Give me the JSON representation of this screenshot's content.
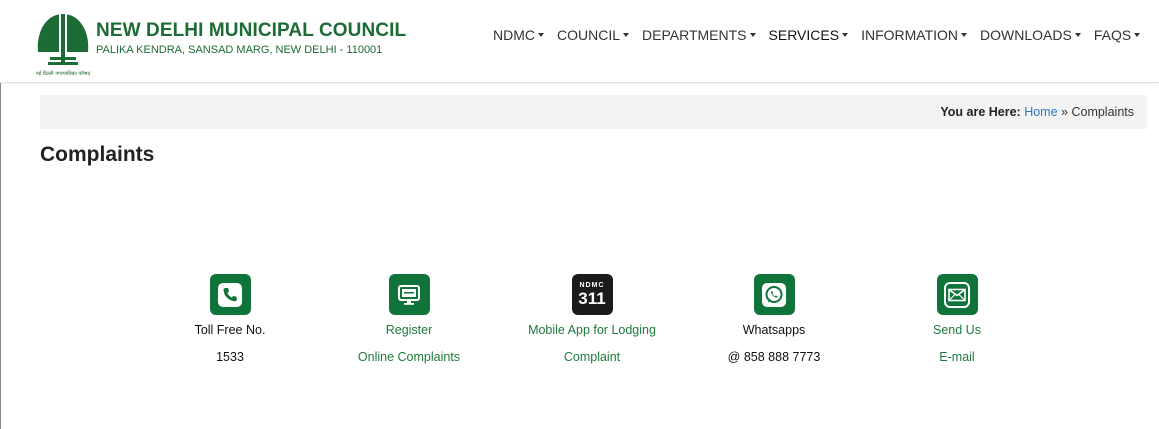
{
  "header": {
    "title": "NEW DELHI MUNICIPAL COUNCIL",
    "subtitle": "PALIKA KENDRA, SANSAD MARG, NEW DELHI - 110001",
    "logo_caption": "नई दिल्ली नगरपालिका परिषद"
  },
  "nav": {
    "items": [
      {
        "label": "NDMC"
      },
      {
        "label": "COUNCIL"
      },
      {
        "label": "DEPARTMENTS"
      },
      {
        "label": "SERVICES"
      },
      {
        "label": "INFORMATION"
      },
      {
        "label": "DOWNLOADS"
      },
      {
        "label": "FAQS"
      }
    ]
  },
  "breadcrumb": {
    "prefix": "You are Here:",
    "home": "Home",
    "separator": "»",
    "current": "Complaints"
  },
  "page": {
    "title": "Complaints"
  },
  "options": [
    {
      "icon": "phone-icon",
      "label": "Toll Free No.",
      "value": "1533"
    },
    {
      "icon": "monitor-icon",
      "label": "Register",
      "value": "Online Complaints"
    },
    {
      "icon": "ndmc-311-app-icon",
      "label": "Mobile App for Lodging",
      "value": "Complaint",
      "app_text": "NDMC",
      "app_number": "311"
    },
    {
      "icon": "whatsapp-icon",
      "label": "Whatsapps",
      "value": "@ 858 888 7773"
    },
    {
      "icon": "mail-icon",
      "label": "Send Us",
      "value": "E-mail"
    }
  ],
  "colors": {
    "brand_green": "#1d6b35",
    "icon_green": "#10743a",
    "link_blue": "#2b7bbd",
    "breadcrumb_bg": "#f3f3f3"
  }
}
